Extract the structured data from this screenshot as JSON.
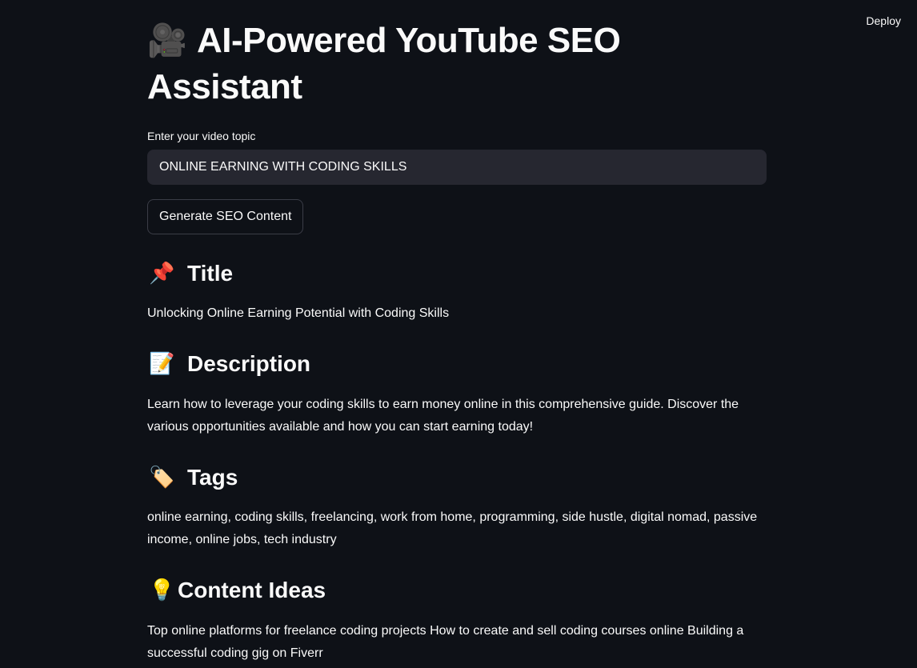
{
  "header": {
    "deploy_label": "Deploy"
  },
  "page": {
    "title_icon": "🎥",
    "title": "AI-Powered YouTube SEO Assistant"
  },
  "form": {
    "input_label": "Enter your video topic",
    "input_value": "ONLINE EARNING WITH CODING SKILLS",
    "button_label": "Generate SEO Content"
  },
  "sections": {
    "title": {
      "icon": "📌",
      "icon_name": "pushpin-icon",
      "heading": "Title",
      "body": "Unlocking Online Earning Potential with Coding Skills"
    },
    "description": {
      "icon": "📝",
      "icon_name": "memo-icon",
      "heading": "Description",
      "body": "Learn how to leverage your coding skills to earn money online in this comprehensive guide. Discover the various opportunities available and how you can start earning today!"
    },
    "tags": {
      "icon": "🏷️",
      "icon_name": "label-tag-icon",
      "heading": "Tags",
      "body": "online earning, coding skills, freelancing, work from home, programming, side hustle, digital nomad, passive income, online jobs, tech industry"
    },
    "ideas": {
      "icon": "💡",
      "icon_name": "light-bulb-icon",
      "heading": "Content Ideas",
      "body": "Top online platforms for freelance coding projects How to create and sell coding courses online Building a successful coding gig on Fiverr"
    }
  },
  "colors": {
    "background": "#0e1117",
    "text": "#fafafa",
    "input_background": "#262730",
    "button_border": "#3b3d47"
  }
}
